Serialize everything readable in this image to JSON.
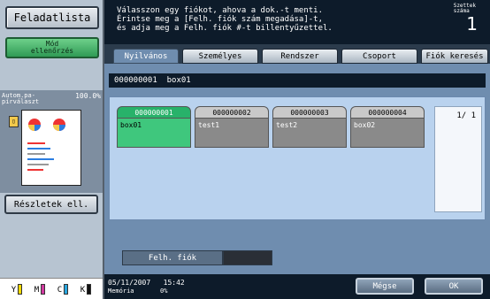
{
  "left": {
    "job_label": "Feladatlista",
    "check_line1": "Mód",
    "check_line2": "ellenőrzés",
    "zoom_label_1": "Autom.pa-",
    "zoom_label_2": "pírválaszt",
    "zoom_value": "100.0%",
    "details_label": "Részletek ell."
  },
  "toner": [
    {
      "letter": "Y",
      "color": "#f2d900"
    },
    {
      "letter": "M",
      "color": "#d23aa0"
    },
    {
      "letter": "C",
      "color": "#2aa7e0"
    },
    {
      "letter": "K",
      "color": "#111111"
    }
  ],
  "message": {
    "line1": "Válasszon egy fiókot, ahova a dok.-t menti.",
    "line2": "Érintse meg a [Felh. fiók szám megadása]-t,",
    "line3": "és adja meg a Felh. fiók #-t billentyűzettel."
  },
  "counter": {
    "label_1": "Szettek",
    "label_2": "száma",
    "value": "1"
  },
  "tabs": [
    "Nyilvános",
    "Személyes",
    "Rendszer",
    "Csoport",
    "Fiók keresés"
  ],
  "address": {
    "number": "000000001",
    "name": "box01"
  },
  "boxes": [
    {
      "number": "000000001",
      "name": "box01",
      "selected": true
    },
    {
      "number": "000000002",
      "name": "test1",
      "selected": false
    },
    {
      "number": "000000003",
      "name": "test2",
      "selected": false
    },
    {
      "number": "000000004",
      "name": "box02",
      "selected": false
    }
  ],
  "pager": "1/ 1",
  "felh_fiok_label": "Felh. fiók",
  "status": {
    "date": "05/11/2007",
    "time": "15:42",
    "memory_label": "Memória",
    "memory_value": "0%"
  },
  "buttons": {
    "cancel": "Mégse",
    "ok": "OK"
  }
}
